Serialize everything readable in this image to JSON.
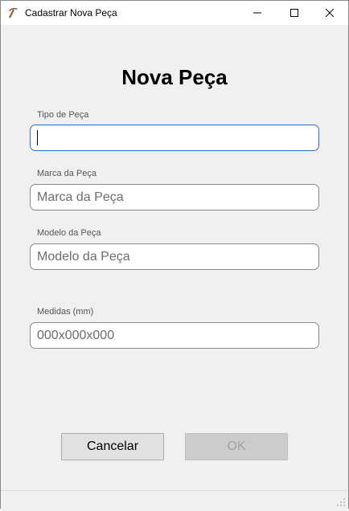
{
  "window": {
    "title": "Cadastrar Nova Peça",
    "app_icon": "pickaxe-icon"
  },
  "form": {
    "heading": "Nova Peça",
    "fields": [
      {
        "label": "Tipo de Peça",
        "value": "",
        "placeholder": ""
      },
      {
        "label": "Marca da Peça",
        "value": "",
        "placeholder": "Marca da Peça"
      },
      {
        "label": "Modelo da Peça",
        "value": "",
        "placeholder": "Modelo da Peça"
      },
      {
        "label": "Medidas (mm)",
        "value": "",
        "placeholder": "000x000x000"
      }
    ]
  },
  "buttons": {
    "cancel_label": "Cancelar",
    "ok_label": "OK"
  },
  "colors": {
    "focus_border": "#2f6fbf",
    "disabled_button": "#cccccc"
  }
}
